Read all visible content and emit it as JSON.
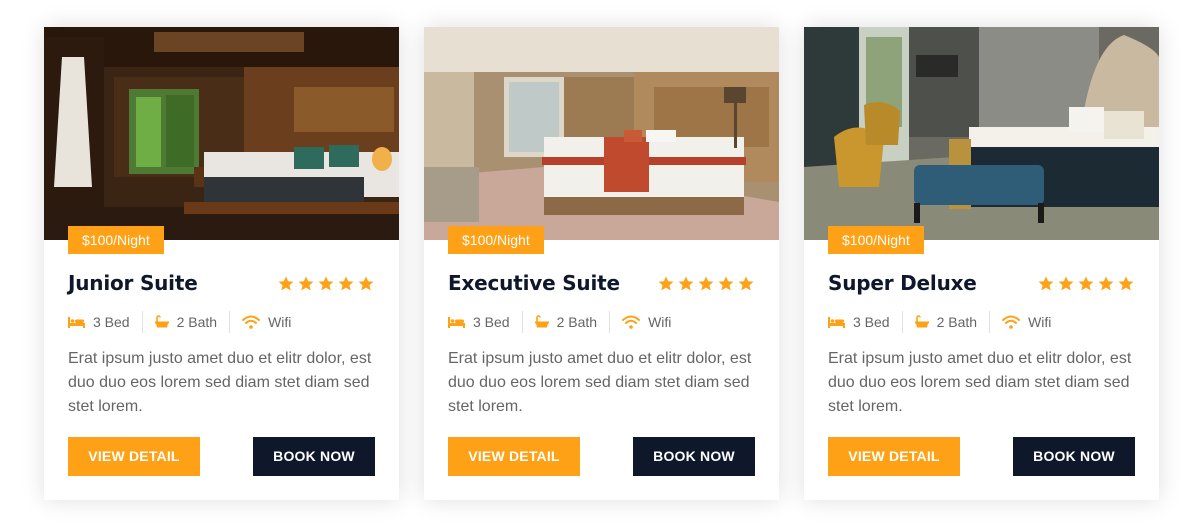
{
  "colors": {
    "primary": "#FEA116",
    "dark": "#0F172B",
    "text": "#666565"
  },
  "rooms": [
    {
      "price": "$100/Night",
      "name": "Junior Suite",
      "rating": 5,
      "amenities": [
        {
          "icon": "bed-icon",
          "label": "3 Bed"
        },
        {
          "icon": "bath-icon",
          "label": "2 Bath"
        },
        {
          "icon": "wifi-icon",
          "label": "Wifi"
        }
      ],
      "description": "Erat ipsum justo amet duo et elitr dolor, est duo duo eos lorem sed diam stet diam sed stet lorem.",
      "detail_label": "VIEW DETAIL",
      "book_label": "BOOK NOW"
    },
    {
      "price": "$100/Night",
      "name": "Executive Suite",
      "rating": 5,
      "amenities": [
        {
          "icon": "bed-icon",
          "label": "3 Bed"
        },
        {
          "icon": "bath-icon",
          "label": "2 Bath"
        },
        {
          "icon": "wifi-icon",
          "label": "Wifi"
        }
      ],
      "description": "Erat ipsum justo amet duo et elitr dolor, est duo duo eos lorem sed diam stet diam sed stet lorem.",
      "detail_label": "VIEW DETAIL",
      "book_label": "BOOK NOW"
    },
    {
      "price": "$100/Night",
      "name": "Super Deluxe",
      "rating": 5,
      "amenities": [
        {
          "icon": "bed-icon",
          "label": "3 Bed"
        },
        {
          "icon": "bath-icon",
          "label": "2 Bath"
        },
        {
          "icon": "wifi-icon",
          "label": "Wifi"
        }
      ],
      "description": "Erat ipsum justo amet duo et elitr dolor, est duo duo eos lorem sed diam stet diam sed stet lorem.",
      "detail_label": "VIEW DETAIL",
      "book_label": "BOOK NOW"
    }
  ]
}
